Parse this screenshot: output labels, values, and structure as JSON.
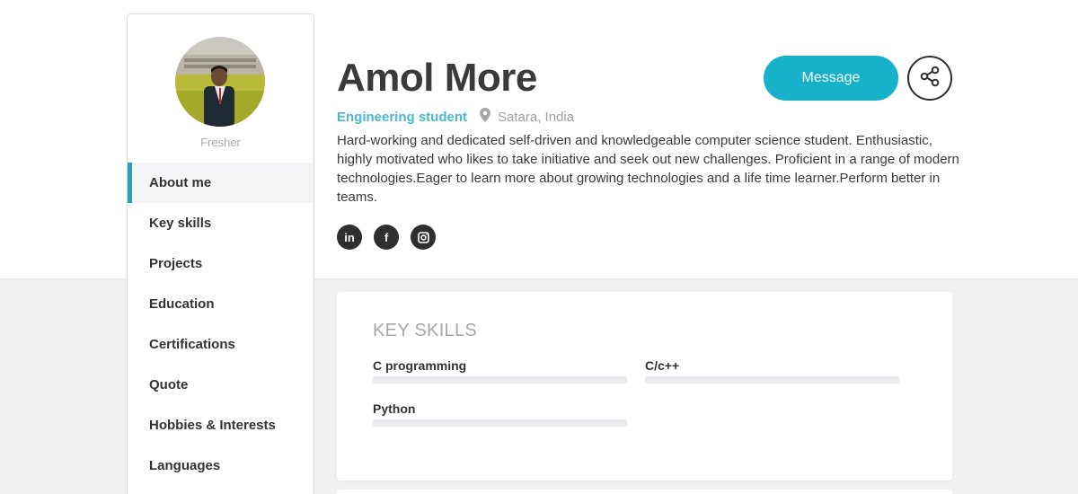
{
  "profile": {
    "name": "Amol More",
    "title": "Engineering student",
    "location": "Satara, India",
    "level": "Fresher",
    "bio": "Hard-working and dedicated self-driven and knowledgeable computer science student. Enthusiastic, highly motivated who likes to take initiative and seek out new challenges. Proficient in a range of modern technologies.Eager to learn more about growing technologies and a life time learner.Perform better in teams."
  },
  "actions": {
    "message_label": "Message",
    "share_icon": "share-icon"
  },
  "socials": [
    {
      "icon": "linkedin-icon",
      "glyph": "in"
    },
    {
      "icon": "facebook-icon",
      "glyph": "f"
    },
    {
      "icon": "instagram-icon",
      "glyph": "◎"
    }
  ],
  "sidebar": {
    "items": [
      {
        "label": "About me",
        "active": true
      },
      {
        "label": "Key skills"
      },
      {
        "label": "Projects"
      },
      {
        "label": "Education"
      },
      {
        "label": "Certifications"
      },
      {
        "label": "Quote"
      },
      {
        "label": "Hobbies & Interests"
      },
      {
        "label": "Languages"
      }
    ]
  },
  "key_skills": {
    "heading": "KEY SKILLS",
    "items": [
      {
        "name": "C programming"
      },
      {
        "name": "C/c++"
      },
      {
        "name": "Python"
      }
    ]
  },
  "colors": {
    "accent": "#17b1c9",
    "title": "#4ab9cc",
    "sidebar_active_bar": "#2a9fb3"
  }
}
